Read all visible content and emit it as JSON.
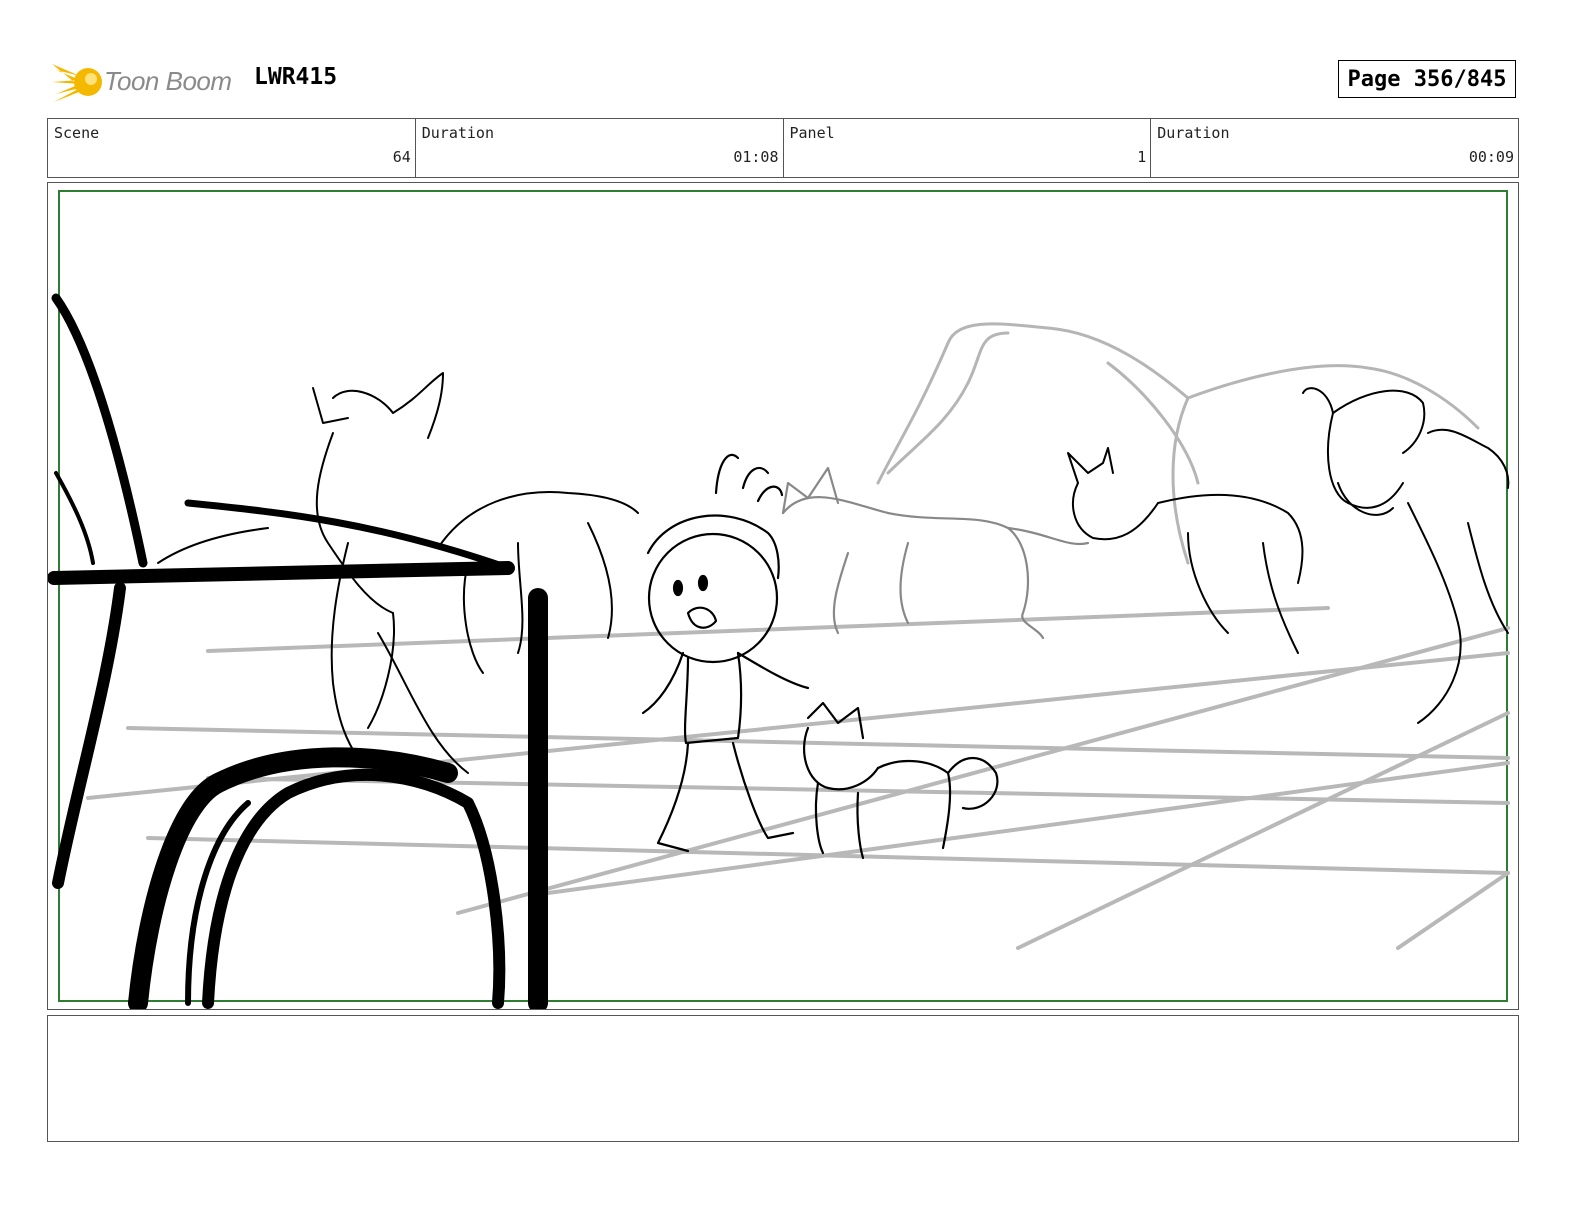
{
  "header": {
    "logo_text": "Toon Boom",
    "project_code": "LWR415",
    "page_label": "Page 356/845"
  },
  "info_bar": {
    "scene": {
      "label": "Scene",
      "value": "64"
    },
    "scene_duration": {
      "label": "Duration",
      "value": "01:08"
    },
    "panel": {
      "label": "Panel",
      "value": "1"
    },
    "panel_duration": {
      "label": "Duration",
      "value": "00:09"
    }
  },
  "colors": {
    "frame_green": "#2e7d32",
    "logo_yellow": "#f5b800",
    "sketch_gray": "#b8b8b8",
    "line_black": "#000000"
  },
  "icons": [
    "toon-boom-logo-icon"
  ],
  "notes": {
    "text": ""
  }
}
